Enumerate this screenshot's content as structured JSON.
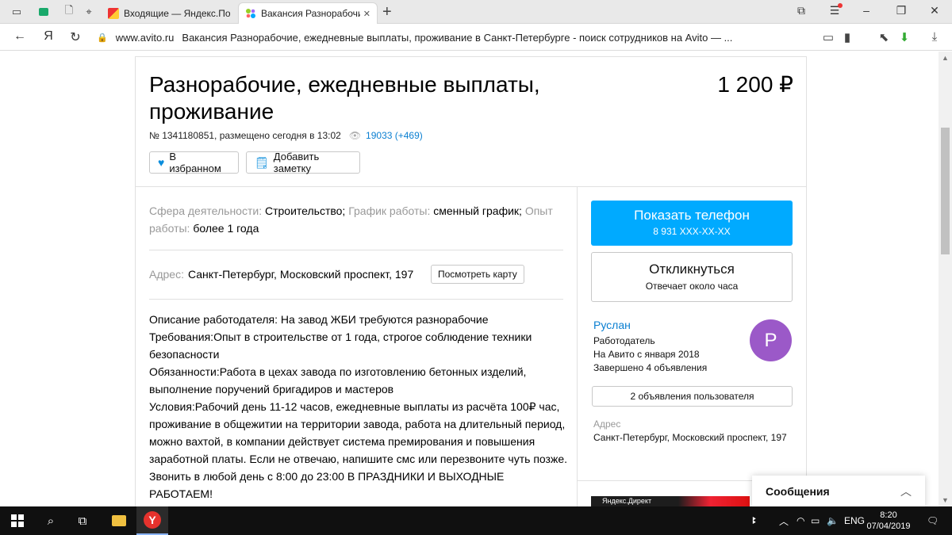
{
  "browser": {
    "tabs": [
      {
        "title": "Входящие — Яндекс.Почта",
        "favicon": "yandex-mail"
      },
      {
        "title": "Вакансия Разнорабочие",
        "favicon": "avito",
        "close": "✕"
      }
    ],
    "new_tab": "+",
    "url_domain": "www.avito.ru",
    "url_title": "Вакансия Разнорабочие, ежедневные выплаты, проживание в Санкт-Петербурге - поиск сотрудников на Avito —  ...",
    "nav_y": "Я"
  },
  "ad": {
    "title": "Разнорабочие, ежедневные выплаты, проживание",
    "price": "1 200 ₽",
    "meta": "№ 1341180851, размещено сегодня в 13:02",
    "views": "19033 (+469)",
    "fav_button": "В избранном",
    "note_button": "Добавить заметку"
  },
  "params": {
    "sphere_label": "Сфера деятельности:",
    "sphere_value": "Строительство;",
    "schedule_label": "График работы:",
    "schedule_value": "сменный график;",
    "exp_label": "Опыт работы:",
    "exp_value": "более 1 года"
  },
  "address": {
    "label": "Адрес:",
    "value": "Санкт-Петербург, Московский проспект, 197",
    "map_button": "Посмотреть карту"
  },
  "description": [
    "Описание работодателя: На завод ЖБИ требуются разнорабочие",
    "Требования:Опыт в строительстве от 1 года, строгое соблюдение техники безопасности",
    "Обязанности:Работа в цехах завода по изготовлению бетонных изделий, выполнение поручений бригадиров и мастеров",
    "Условия:Рабочий день 11-12 часов, ежедневные выплаты из расчёта 100₽ час, проживание в общежитии на территории завода, работа на длительный период, можно вахтой, в компании действует система премирования и повышения заработной платы. Если не отвечаю, напишите смс или перезвоните чуть позже. Звонить в любой день с 8:00 до 23:00 В ПРАЗДНИКИ И ВЫХОДНЫЕ РАБОТАЕМ!"
  ],
  "sidebar": {
    "phone_button": "Показать телефон",
    "phone_number": "8 931 XXX-XX-XX",
    "respond_button": "Откликнуться",
    "respond_sub": "Отвечает около часа",
    "seller_name": "Руслан",
    "seller_type": "Работодатель",
    "seller_since": "На Авито с января 2018",
    "seller_done": "Завершено 4 объявления",
    "avatar_letter": "Р",
    "user_ads_button": "2 объявления пользователя",
    "addr_label": "Адрес",
    "addr_value": "Санкт-Петербург, Московский проспект, 197",
    "direct_label": "Яндекс.Директ"
  },
  "messages": {
    "label": "Сообщения"
  },
  "taskbar": {
    "lang": "ENG",
    "time": "8:20",
    "date": "07/04/2019"
  },
  "colors": {
    "accent": "#00aaff",
    "link": "#0a7fd1",
    "avatar": "#9b59c8"
  }
}
